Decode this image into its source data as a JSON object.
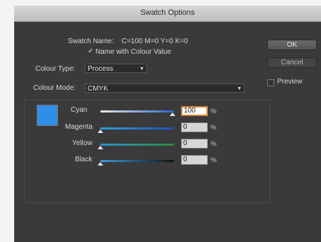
{
  "dialog": {
    "title": "Swatch Options",
    "swatch_name_label": "Swatch Name:",
    "swatch_name_value": "C=100 M=0 Y=0 K=0",
    "name_with_colour_value_label": "Name with Colour Value",
    "name_with_colour_value_checked": true,
    "colour_type_label": "Colour Type:",
    "colour_type_value": "Process",
    "colour_mode_label": "Colour Mode:",
    "colour_mode_value": "CMYK",
    "swatch_color": "#2e8ee8",
    "sliders": [
      {
        "label": "Cyan",
        "value": "100",
        "percent": "%",
        "color": "#2f66c8"
      },
      {
        "label": "Magenta",
        "value": "0",
        "percent": "%",
        "color": "#1f4fb4"
      },
      {
        "label": "Yellow",
        "value": "0",
        "percent": "%",
        "color": "#2f8a3c"
      },
      {
        "label": "Black",
        "value": "0",
        "percent": "%",
        "color": "#1e5aa8"
      }
    ],
    "buttons": {
      "ok": "OK",
      "cancel": "Cancel"
    },
    "preview_label": "Preview",
    "preview_checked": false
  }
}
